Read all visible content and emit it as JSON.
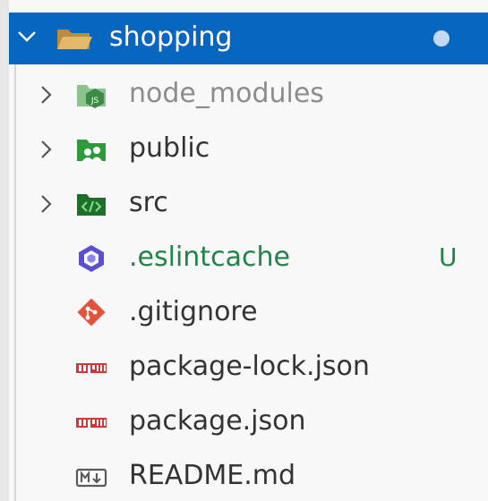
{
  "explorer": {
    "root": {
      "label": "shopping",
      "icon": "folder-open-icon",
      "expanded": true,
      "modified_dot": true
    },
    "items": [
      {
        "label": "node_modules",
        "type": "folder",
        "icon": "nodejs-folder-icon",
        "expanded": false,
        "status": ""
      },
      {
        "label": "public",
        "type": "folder",
        "icon": "public-folder-icon",
        "expanded": false,
        "status": ""
      },
      {
        "label": "src",
        "type": "folder",
        "icon": "src-folder-icon",
        "expanded": false,
        "status": ""
      },
      {
        "label": ".eslintcache",
        "type": "file",
        "icon": "eslint-icon",
        "status": "U"
      },
      {
        "label": ".gitignore",
        "type": "file",
        "icon": "git-icon",
        "status": ""
      },
      {
        "label": "package-lock.json",
        "type": "file",
        "icon": "npm-icon",
        "status": ""
      },
      {
        "label": "package.json",
        "type": "file",
        "icon": "npm-icon",
        "status": ""
      },
      {
        "label": "README.md",
        "type": "file",
        "icon": "markdown-icon",
        "status": ""
      }
    ]
  },
  "colors": {
    "selection": "#0766bf",
    "untracked": "#20834a",
    "text": "#333333",
    "ignored": "#8c8c8c"
  }
}
